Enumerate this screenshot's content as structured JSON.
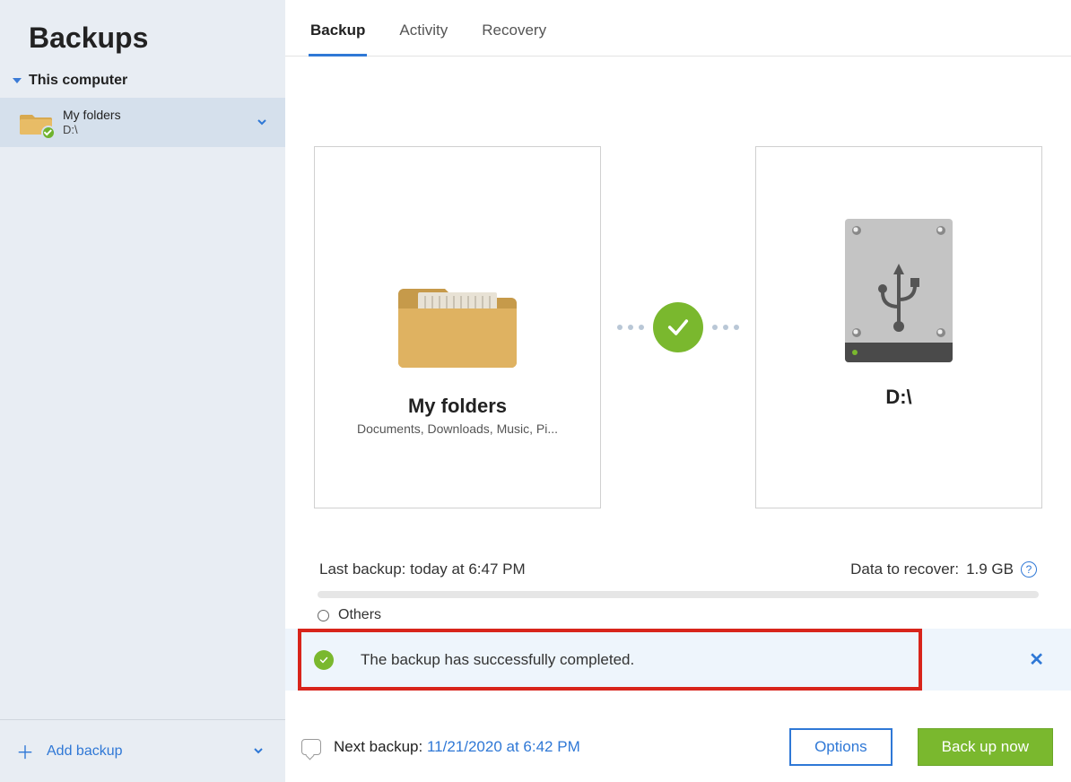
{
  "sidebar": {
    "title": "Backups",
    "section_label": "This computer",
    "item": {
      "name": "My folders",
      "destination": "D:\\"
    },
    "add_label": "Add backup"
  },
  "tabs": {
    "backup": "Backup",
    "activity": "Activity",
    "recovery": "Recovery"
  },
  "source_card": {
    "title": "My folders",
    "subtitle": "Documents, Downloads, Music, Pi..."
  },
  "dest_card": {
    "title": "D:\\"
  },
  "stats": {
    "last_backup_label": "Last backup:",
    "last_backup_value": "today at 6:47 PM",
    "recover_label": "Data to recover:",
    "recover_value": "1.9 GB"
  },
  "others_label": "Others",
  "notification": {
    "text": "The backup has successfully completed."
  },
  "footer": {
    "next_label": "Next backup:",
    "next_value": "11/21/2020 at 6:42 PM",
    "options": "Options",
    "backup_now": "Back up now"
  }
}
